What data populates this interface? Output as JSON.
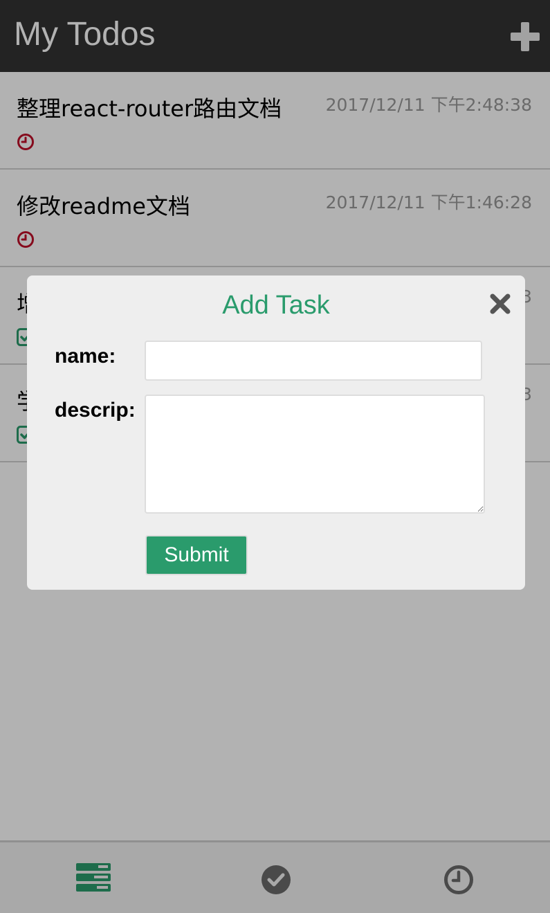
{
  "app": {
    "title": "My Todos"
  },
  "colors": {
    "accent": "#2a9b6c",
    "pending": "#c0102a",
    "header_bg": "#333333"
  },
  "todos": [
    {
      "name": "整理react-router路由文档",
      "time": "2017/12/11 下午2:48:38",
      "status": "pending",
      "status_icon": "clock-icon"
    },
    {
      "name": "修改readme文档",
      "time": "2017/12/11 下午1:46:28",
      "status": "pending",
      "status_icon": "clock-icon"
    },
    {
      "name": "增",
      "time": "3",
      "status": "done",
      "status_icon": "checkbox-icon"
    },
    {
      "name": "学",
      "time": "3",
      "status": "done",
      "status_icon": "checkbox-icon"
    }
  ],
  "modal": {
    "title": "Add Task",
    "name_label": "name:",
    "descrip_label": "descrip:",
    "name_value": "",
    "descrip_value": "",
    "submit_label": "Submit",
    "close_icon": "close-icon"
  },
  "footer": {
    "tabs": [
      {
        "name": "all-tasks",
        "icon": "list-icon",
        "active": true
      },
      {
        "name": "completed-tasks",
        "icon": "check-circle-icon",
        "active": false
      },
      {
        "name": "pending-tasks",
        "icon": "clock-icon",
        "active": false
      }
    ]
  }
}
